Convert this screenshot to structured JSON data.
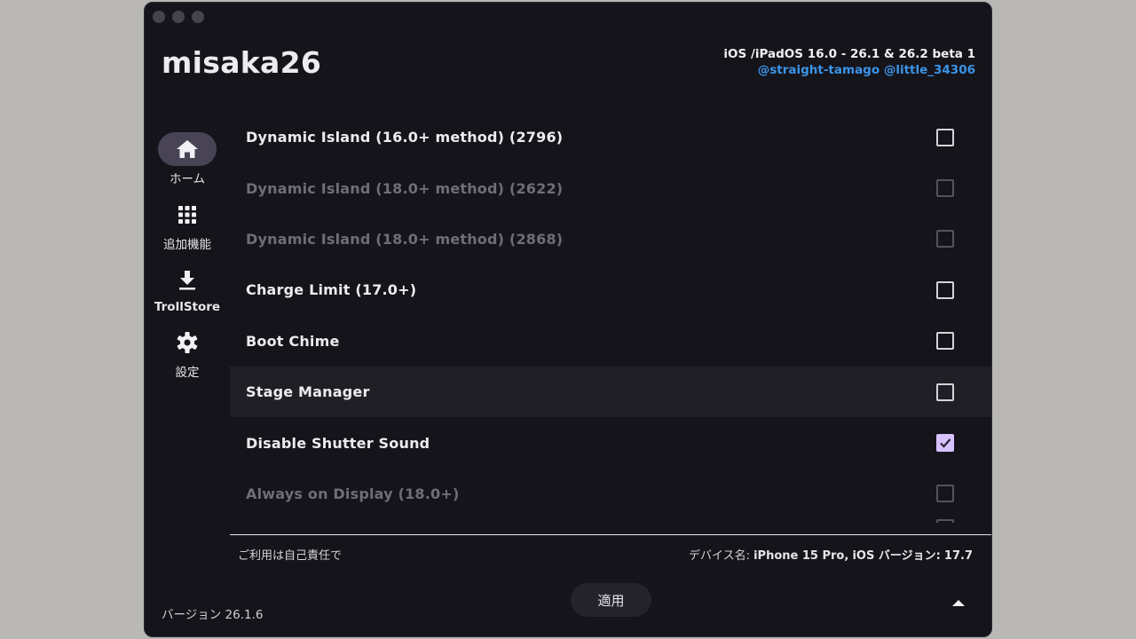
{
  "window": {
    "title": "misaka26"
  },
  "header": {
    "ios_range": "iOS /iPadOS 16.0 - 26.1 & 26.2 beta 1",
    "credits": [
      "@straight-tamago",
      "@little_34306"
    ]
  },
  "sidebar": {
    "items": [
      {
        "label": "ホーム",
        "icon": "home-icon",
        "active": true
      },
      {
        "label": "追加機能",
        "icon": "grid-icon",
        "active": false
      },
      {
        "label": "TrollStore",
        "icon": "download-icon",
        "active": false
      },
      {
        "label": "設定",
        "icon": "gear-icon",
        "active": false
      }
    ]
  },
  "tweaks": [
    {
      "label": "Dynamic Island (16.0+ method) (2796)",
      "checked": false,
      "enabled": true
    },
    {
      "label": "Dynamic Island (18.0+ method) (2622)",
      "checked": false,
      "enabled": false
    },
    {
      "label": "Dynamic Island (18.0+ method) (2868)",
      "checked": false,
      "enabled": false
    },
    {
      "label": "Charge Limit (17.0+)",
      "checked": false,
      "enabled": true
    },
    {
      "label": "Boot Chime",
      "checked": false,
      "enabled": true
    },
    {
      "label": "Stage Manager",
      "checked": false,
      "enabled": true
    },
    {
      "label": "Disable Shutter Sound",
      "checked": true,
      "enabled": true
    },
    {
      "label": "Always on Display (18.0+)",
      "checked": false,
      "enabled": false
    }
  ],
  "footer": {
    "disclaimer": "ご利用は自己責任で",
    "device_label": "デバイス名:",
    "device_name": "iPhone 15 Pro,",
    "ios_label": "iOS バージョン:",
    "ios_version": "17.7",
    "version": "バージョン 26.1.6",
    "apply_label": "適用"
  },
  "colors": {
    "accent": "#d7c2ff",
    "link": "#3a94e8",
    "background": "#16141b"
  }
}
